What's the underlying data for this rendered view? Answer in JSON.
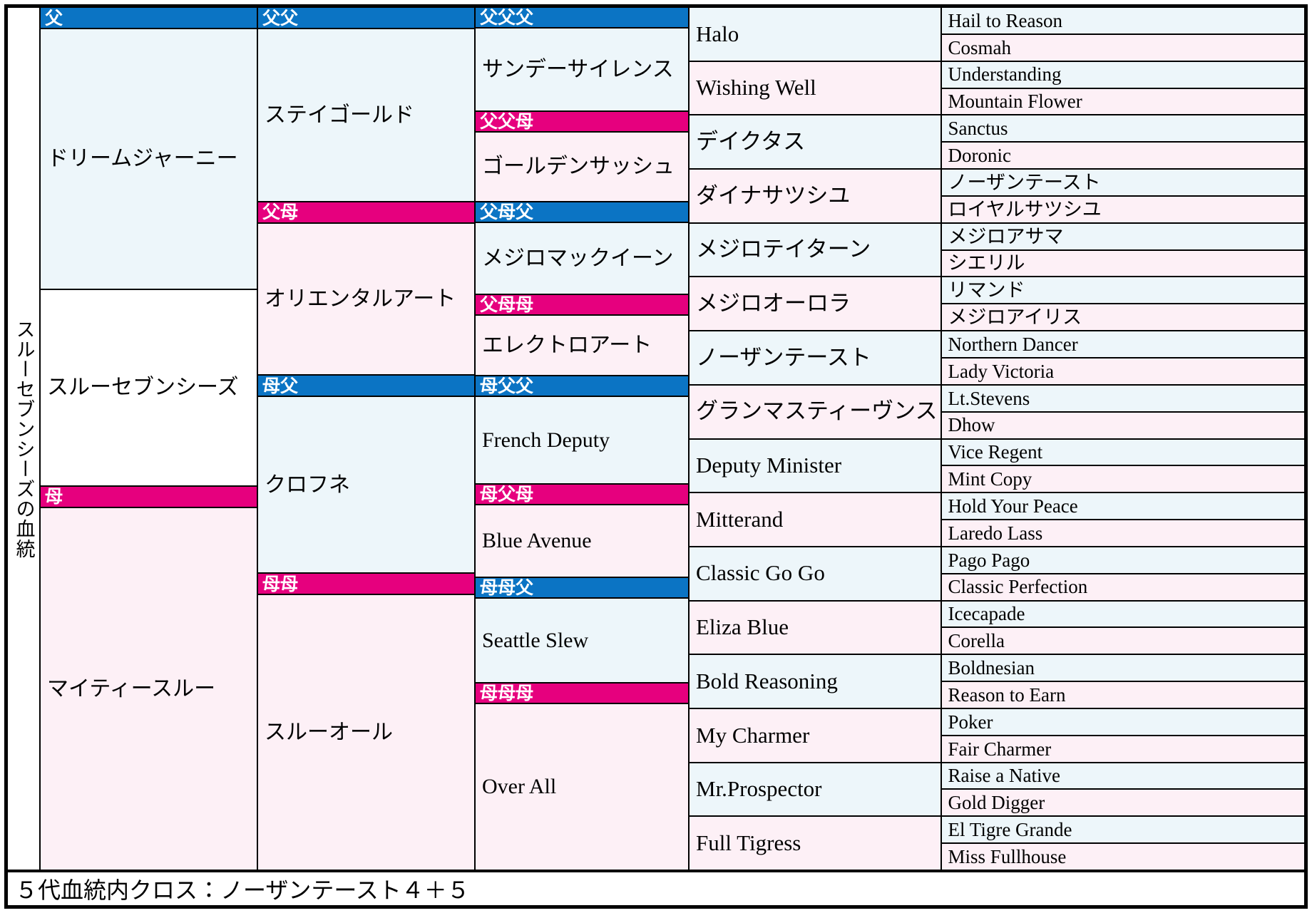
{
  "title_vertical": "スルーセブンシーズの血統",
  "colors": {
    "sire_label_bg": "#0b74c4",
    "dam_label_bg": "#e6007e",
    "sire_cell_bg": "#edf6fa",
    "dam_cell_bg": "#fdf0f6",
    "subject_cell_bg": "#ffffff",
    "label_text": "#ffffff",
    "border": "#000000"
  },
  "footer": {
    "cross_note": "５代血統内クロス：ノーザンテースト４＋５"
  },
  "gen1": [
    {
      "label": "父",
      "name": "ドリームジャーニー",
      "tone": "blue"
    },
    {
      "label": "",
      "name": "スルーセブンシーズ",
      "tone": "white"
    },
    {
      "label": "母",
      "name": "マイティースルー",
      "tone": "pink"
    }
  ],
  "gen2": [
    {
      "label": "父父",
      "name": "ステイゴールド",
      "tone": "blue"
    },
    {
      "label": "父母",
      "name": "オリエンタルアート",
      "tone": "pink"
    },
    {
      "label": "母父",
      "name": "クロフネ",
      "tone": "blue"
    },
    {
      "label": "母母",
      "name": "スルーオール",
      "tone": "pink"
    }
  ],
  "gen3": [
    {
      "label": "父父父",
      "name": "サンデーサイレンス",
      "tone": "blue"
    },
    {
      "label": "父父母",
      "name": "ゴールデンサッシュ",
      "tone": "pink"
    },
    {
      "label": "父母父",
      "name": "メジロマックイーン",
      "tone": "blue"
    },
    {
      "label": "父母母",
      "name": "エレクトロアート",
      "tone": "pink"
    },
    {
      "label": "母父父",
      "name": "French Deputy",
      "tone": "blue"
    },
    {
      "label": "母父母",
      "name": "Blue Avenue",
      "tone": "pink"
    },
    {
      "label": "母母父",
      "name": "Seattle Slew",
      "tone": "blue"
    },
    {
      "label": "母母母",
      "name": "Over All",
      "tone": "pink"
    }
  ],
  "gen4": [
    {
      "name": "Halo",
      "tone": "blue"
    },
    {
      "name": "Wishing Well",
      "tone": "pink"
    },
    {
      "name": "デイクタス",
      "tone": "blue"
    },
    {
      "name": "ダイナサツシユ",
      "tone": "pink"
    },
    {
      "name": "メジロテイターン",
      "tone": "blue"
    },
    {
      "name": "メジロオーロラ",
      "tone": "pink"
    },
    {
      "name": "ノーザンテースト",
      "tone": "blue"
    },
    {
      "name": "グランマスティーヴンス",
      "tone": "pink"
    },
    {
      "name": "Deputy Minister",
      "tone": "blue"
    },
    {
      "name": "Mitterand",
      "tone": "pink"
    },
    {
      "name": "Classic Go Go",
      "tone": "blue"
    },
    {
      "name": "Eliza Blue",
      "tone": "pink"
    },
    {
      "name": "Bold Reasoning",
      "tone": "blue"
    },
    {
      "name": "My Charmer",
      "tone": "pink"
    },
    {
      "name": "Mr.Prospector",
      "tone": "blue"
    },
    {
      "name": "Full Tigress",
      "tone": "pink"
    }
  ],
  "gen5": [
    {
      "name": "Hail to Reason",
      "tone": "blue"
    },
    {
      "name": "Cosmah",
      "tone": "pink"
    },
    {
      "name": "Understanding",
      "tone": "blue"
    },
    {
      "name": "Mountain Flower",
      "tone": "pink"
    },
    {
      "name": "Sanctus",
      "tone": "blue"
    },
    {
      "name": "Doronic",
      "tone": "pink"
    },
    {
      "name": "ノーザンテースト",
      "tone": "blue"
    },
    {
      "name": "ロイヤルサツシユ",
      "tone": "pink"
    },
    {
      "name": "メジロアサマ",
      "tone": "blue"
    },
    {
      "name": "シエリル",
      "tone": "pink"
    },
    {
      "name": "リマンド",
      "tone": "blue"
    },
    {
      "name": "メジロアイリス",
      "tone": "pink"
    },
    {
      "name": "Northern Dancer",
      "tone": "blue"
    },
    {
      "name": "Lady Victoria",
      "tone": "pink"
    },
    {
      "name": "Lt.Stevens",
      "tone": "blue"
    },
    {
      "name": "Dhow",
      "tone": "pink"
    },
    {
      "name": "Vice Regent",
      "tone": "blue"
    },
    {
      "name": "Mint Copy",
      "tone": "pink"
    },
    {
      "name": "Hold Your Peace",
      "tone": "blue"
    },
    {
      "name": "Laredo Lass",
      "tone": "pink"
    },
    {
      "name": "Pago Pago",
      "tone": "blue"
    },
    {
      "name": "Classic Perfection",
      "tone": "pink"
    },
    {
      "name": "Icecapade",
      "tone": "blue"
    },
    {
      "name": "Corella",
      "tone": "pink"
    },
    {
      "name": "Boldnesian",
      "tone": "blue"
    },
    {
      "name": "Reason to Earn",
      "tone": "pink"
    },
    {
      "name": "Poker",
      "tone": "blue"
    },
    {
      "name": "Fair Charmer",
      "tone": "pink"
    },
    {
      "name": "Raise a Native",
      "tone": "blue"
    },
    {
      "name": "Gold Digger",
      "tone": "pink"
    },
    {
      "name": "El Tigre Grande",
      "tone": "blue"
    },
    {
      "name": "Miss Fullhouse",
      "tone": "pink"
    }
  ]
}
